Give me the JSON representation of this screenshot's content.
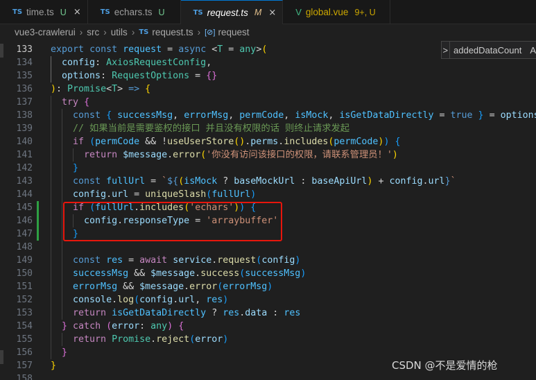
{
  "tabs": [
    {
      "lang": "TS",
      "label": "time.ts",
      "modifier": "U",
      "close": "×",
      "active": false,
      "italic": false
    },
    {
      "lang": "TS",
      "label": "echars.ts",
      "modifier": "U",
      "close": "",
      "active": false,
      "italic": false
    },
    {
      "lang": "TS",
      "label": "request.ts",
      "modifier": "M",
      "close": "×",
      "active": true,
      "italic": true
    },
    {
      "lang": "V",
      "label": "global.vue",
      "modifier": "9+, U",
      "close": "",
      "active": false,
      "italic": false
    }
  ],
  "breadcrumb": {
    "root": "vue3-crawlerui",
    "src": "src",
    "utils": "utils",
    "file_lang": "TS",
    "file": "request.ts",
    "symbol_icon": "[⊘]",
    "symbol": "request",
    "separator": "›"
  },
  "sticky_widget": {
    "chevron": ">",
    "label": "addedDataCount",
    "trailing": "A"
  },
  "watermark": "CSDN @不是爱情的枪",
  "lines": [
    {
      "n": "133",
      "tokens": [
        [
          "kw",
          "export"
        ],
        [
          "op",
          " "
        ],
        [
          "kw",
          "const"
        ],
        [
          "op",
          " "
        ],
        [
          "const",
          "request"
        ],
        [
          "op",
          " = "
        ],
        [
          "kw",
          "async"
        ],
        [
          "op",
          " <"
        ],
        [
          "typ",
          "T"
        ],
        [
          "op",
          " = "
        ],
        [
          "typ",
          "any"
        ],
        [
          "op",
          ">"
        ],
        [
          "br1",
          "("
        ]
      ]
    },
    {
      "n": "134",
      "tokens": [
        [
          "op",
          "  "
        ],
        [
          "var",
          "config"
        ],
        [
          "op",
          ": "
        ],
        [
          "typ",
          "AxiosRequestConfig"
        ],
        [
          "op",
          ","
        ]
      ]
    },
    {
      "n": "135",
      "tokens": [
        [
          "op",
          "  "
        ],
        [
          "var",
          "options"
        ],
        [
          "op",
          ": "
        ],
        [
          "typ",
          "RequestOptions"
        ],
        [
          "op",
          " = "
        ],
        [
          "br2",
          "{}"
        ]
      ]
    },
    {
      "n": "136",
      "tokens": [
        [
          "br1",
          ")"
        ],
        [
          "op",
          ": "
        ],
        [
          "typ",
          "Promise"
        ],
        [
          "op",
          "<"
        ],
        [
          "typ",
          "T"
        ],
        [
          "op",
          "> "
        ],
        [
          "kw",
          "=>"
        ],
        [
          "op",
          " "
        ],
        [
          "br1",
          "{"
        ]
      ]
    },
    {
      "n": "137",
      "tokens": [
        [
          "op",
          "  "
        ],
        [
          "ctl",
          "try"
        ],
        [
          "op",
          " "
        ],
        [
          "br2",
          "{"
        ]
      ]
    },
    {
      "n": "138",
      "tokens": [
        [
          "op",
          "    "
        ],
        [
          "kw",
          "const"
        ],
        [
          "op",
          " "
        ],
        [
          "br3",
          "{"
        ],
        [
          "op",
          " "
        ],
        [
          "const",
          "successMsg"
        ],
        [
          "op",
          ", "
        ],
        [
          "const",
          "errorMsg"
        ],
        [
          "op",
          ", "
        ],
        [
          "const",
          "permCode"
        ],
        [
          "op",
          ", "
        ],
        [
          "const",
          "isMock"
        ],
        [
          "op",
          ", "
        ],
        [
          "const",
          "isGetDataDirectly"
        ],
        [
          "op",
          " = "
        ],
        [
          "kw",
          "true"
        ],
        [
          "op",
          " "
        ],
        [
          "br3",
          "}"
        ],
        [
          "op",
          " = "
        ],
        [
          "var",
          "options"
        ]
      ]
    },
    {
      "n": "139",
      "tokens": [
        [
          "op",
          "    "
        ],
        [
          "cmt",
          "// 如果当前是需要鉴权的接口 并且没有权限的话 则终止请求发起"
        ]
      ]
    },
    {
      "n": "140",
      "tokens": [
        [
          "op",
          "    "
        ],
        [
          "ctl",
          "if"
        ],
        [
          "op",
          " "
        ],
        [
          "br3",
          "("
        ],
        [
          "const",
          "permCode"
        ],
        [
          "op",
          " && !"
        ],
        [
          "fn",
          "useUserStore"
        ],
        [
          "br1",
          "()"
        ],
        [
          "op",
          "."
        ],
        [
          "var",
          "perms"
        ],
        [
          "op",
          "."
        ],
        [
          "fn",
          "includes"
        ],
        [
          "br1",
          "("
        ],
        [
          "const",
          "permCode"
        ],
        [
          "br1",
          ")"
        ],
        [
          "br3",
          ")"
        ],
        [
          "op",
          " "
        ],
        [
          "br3",
          "{"
        ]
      ]
    },
    {
      "n": "141",
      "tokens": [
        [
          "op",
          "      "
        ],
        [
          "ctl",
          "return"
        ],
        [
          "op",
          " "
        ],
        [
          "var",
          "$message"
        ],
        [
          "op",
          "."
        ],
        [
          "fn",
          "error"
        ],
        [
          "br1",
          "("
        ],
        [
          "str",
          "'你没有访问该接口的权限，请联系管理员！'"
        ],
        [
          "br1",
          ")"
        ]
      ]
    },
    {
      "n": "142",
      "tokens": [
        [
          "op",
          "    "
        ],
        [
          "br3",
          "}"
        ]
      ]
    },
    {
      "n": "143",
      "tokens": [
        [
          "op",
          "    "
        ],
        [
          "kw",
          "const"
        ],
        [
          "op",
          " "
        ],
        [
          "const",
          "fullUrl"
        ],
        [
          "op",
          " = "
        ],
        [
          "str",
          "`"
        ],
        [
          "kw",
          "${"
        ],
        [
          "br1",
          "("
        ],
        [
          "const",
          "isMock"
        ],
        [
          "op",
          " ? "
        ],
        [
          "var",
          "baseMockUrl"
        ],
        [
          "op",
          " : "
        ],
        [
          "var",
          "baseApiUrl"
        ],
        [
          "br1",
          ")"
        ],
        [
          "op",
          " + "
        ],
        [
          "var",
          "config"
        ],
        [
          "op",
          "."
        ],
        [
          "var",
          "url"
        ],
        [
          "kw",
          "}"
        ],
        [
          "str",
          "`"
        ]
      ]
    },
    {
      "n": "144",
      "tokens": [
        [
          "op",
          "    "
        ],
        [
          "var",
          "config"
        ],
        [
          "op",
          "."
        ],
        [
          "var",
          "url"
        ],
        [
          "op",
          " = "
        ],
        [
          "fn",
          "uniqueSlash"
        ],
        [
          "br3",
          "("
        ],
        [
          "const",
          "fullUrl"
        ],
        [
          "br3",
          ")"
        ]
      ]
    },
    {
      "n": "145",
      "tokens": [
        [
          "op",
          "    "
        ],
        [
          "ctl",
          "if"
        ],
        [
          "op",
          " "
        ],
        [
          "br3",
          "("
        ],
        [
          "const",
          "fullUrl"
        ],
        [
          "op",
          "."
        ],
        [
          "fn",
          "includes"
        ],
        [
          "br1",
          "("
        ],
        [
          "str",
          "'echars'"
        ],
        [
          "br1",
          ")"
        ],
        [
          "br3",
          ")"
        ],
        [
          "op",
          " "
        ],
        [
          "br3",
          "{"
        ]
      ]
    },
    {
      "n": "146",
      "tokens": [
        [
          "op",
          "      "
        ],
        [
          "var",
          "config"
        ],
        [
          "op",
          "."
        ],
        [
          "var",
          "responseType"
        ],
        [
          "op",
          " = "
        ],
        [
          "str",
          "'arraybuffer'"
        ]
      ]
    },
    {
      "n": "147",
      "tokens": [
        [
          "op",
          "    "
        ],
        [
          "br3",
          "}"
        ]
      ]
    },
    {
      "n": "148",
      "tokens": []
    },
    {
      "n": "149",
      "tokens": [
        [
          "op",
          "    "
        ],
        [
          "kw",
          "const"
        ],
        [
          "op",
          " "
        ],
        [
          "const",
          "res"
        ],
        [
          "op",
          " = "
        ],
        [
          "ctl",
          "await"
        ],
        [
          "op",
          " "
        ],
        [
          "var",
          "service"
        ],
        [
          "op",
          "."
        ],
        [
          "fn",
          "request"
        ],
        [
          "br3",
          "("
        ],
        [
          "var",
          "config"
        ],
        [
          "br3",
          ")"
        ]
      ]
    },
    {
      "n": "150",
      "tokens": [
        [
          "op",
          "    "
        ],
        [
          "const",
          "successMsg"
        ],
        [
          "op",
          " && "
        ],
        [
          "var",
          "$message"
        ],
        [
          "op",
          "."
        ],
        [
          "fn",
          "success"
        ],
        [
          "br3",
          "("
        ],
        [
          "const",
          "successMsg"
        ],
        [
          "br3",
          ")"
        ]
      ]
    },
    {
      "n": "151",
      "tokens": [
        [
          "op",
          "    "
        ],
        [
          "const",
          "errorMsg"
        ],
        [
          "op",
          " && "
        ],
        [
          "var",
          "$message"
        ],
        [
          "op",
          "."
        ],
        [
          "fn",
          "error"
        ],
        [
          "br3",
          "("
        ],
        [
          "const",
          "errorMsg"
        ],
        [
          "br3",
          ")"
        ]
      ]
    },
    {
      "n": "152",
      "tokens": [
        [
          "op",
          "    "
        ],
        [
          "var",
          "console"
        ],
        [
          "op",
          "."
        ],
        [
          "fn",
          "log"
        ],
        [
          "br3",
          "("
        ],
        [
          "var",
          "config"
        ],
        [
          "op",
          "."
        ],
        [
          "var",
          "url"
        ],
        [
          "op",
          ", "
        ],
        [
          "const",
          "res"
        ],
        [
          "br3",
          ")"
        ]
      ]
    },
    {
      "n": "153",
      "tokens": [
        [
          "op",
          "    "
        ],
        [
          "ctl",
          "return"
        ],
        [
          "op",
          " "
        ],
        [
          "const",
          "isGetDataDirectly"
        ],
        [
          "op",
          " ? "
        ],
        [
          "const",
          "res"
        ],
        [
          "op",
          "."
        ],
        [
          "var",
          "data"
        ],
        [
          "op",
          " : "
        ],
        [
          "const",
          "res"
        ]
      ]
    },
    {
      "n": "154",
      "tokens": [
        [
          "op",
          "  "
        ],
        [
          "br2",
          "}"
        ],
        [
          "op",
          " "
        ],
        [
          "ctl",
          "catch"
        ],
        [
          "op",
          " "
        ],
        [
          "br2",
          "("
        ],
        [
          "var",
          "error"
        ],
        [
          "op",
          ": "
        ],
        [
          "typ",
          "any"
        ],
        [
          "br2",
          ")"
        ],
        [
          "op",
          " "
        ],
        [
          "br2",
          "{"
        ]
      ]
    },
    {
      "n": "155",
      "tokens": [
        [
          "op",
          "    "
        ],
        [
          "ctl",
          "return"
        ],
        [
          "op",
          " "
        ],
        [
          "typ",
          "Promise"
        ],
        [
          "op",
          "."
        ],
        [
          "fn",
          "reject"
        ],
        [
          "br3",
          "("
        ],
        [
          "var",
          "error"
        ],
        [
          "br3",
          ")"
        ]
      ]
    },
    {
      "n": "156",
      "tokens": [
        [
          "op",
          "  "
        ],
        [
          "br2",
          "}"
        ]
      ]
    },
    {
      "n": "157",
      "tokens": [
        [
          "br1",
          "}"
        ]
      ]
    },
    {
      "n": "158",
      "tokens": []
    }
  ],
  "colors": {
    "highlight_box": "#e8160c",
    "modified_gutter": "#2ea043",
    "accent": "#0078d4"
  }
}
